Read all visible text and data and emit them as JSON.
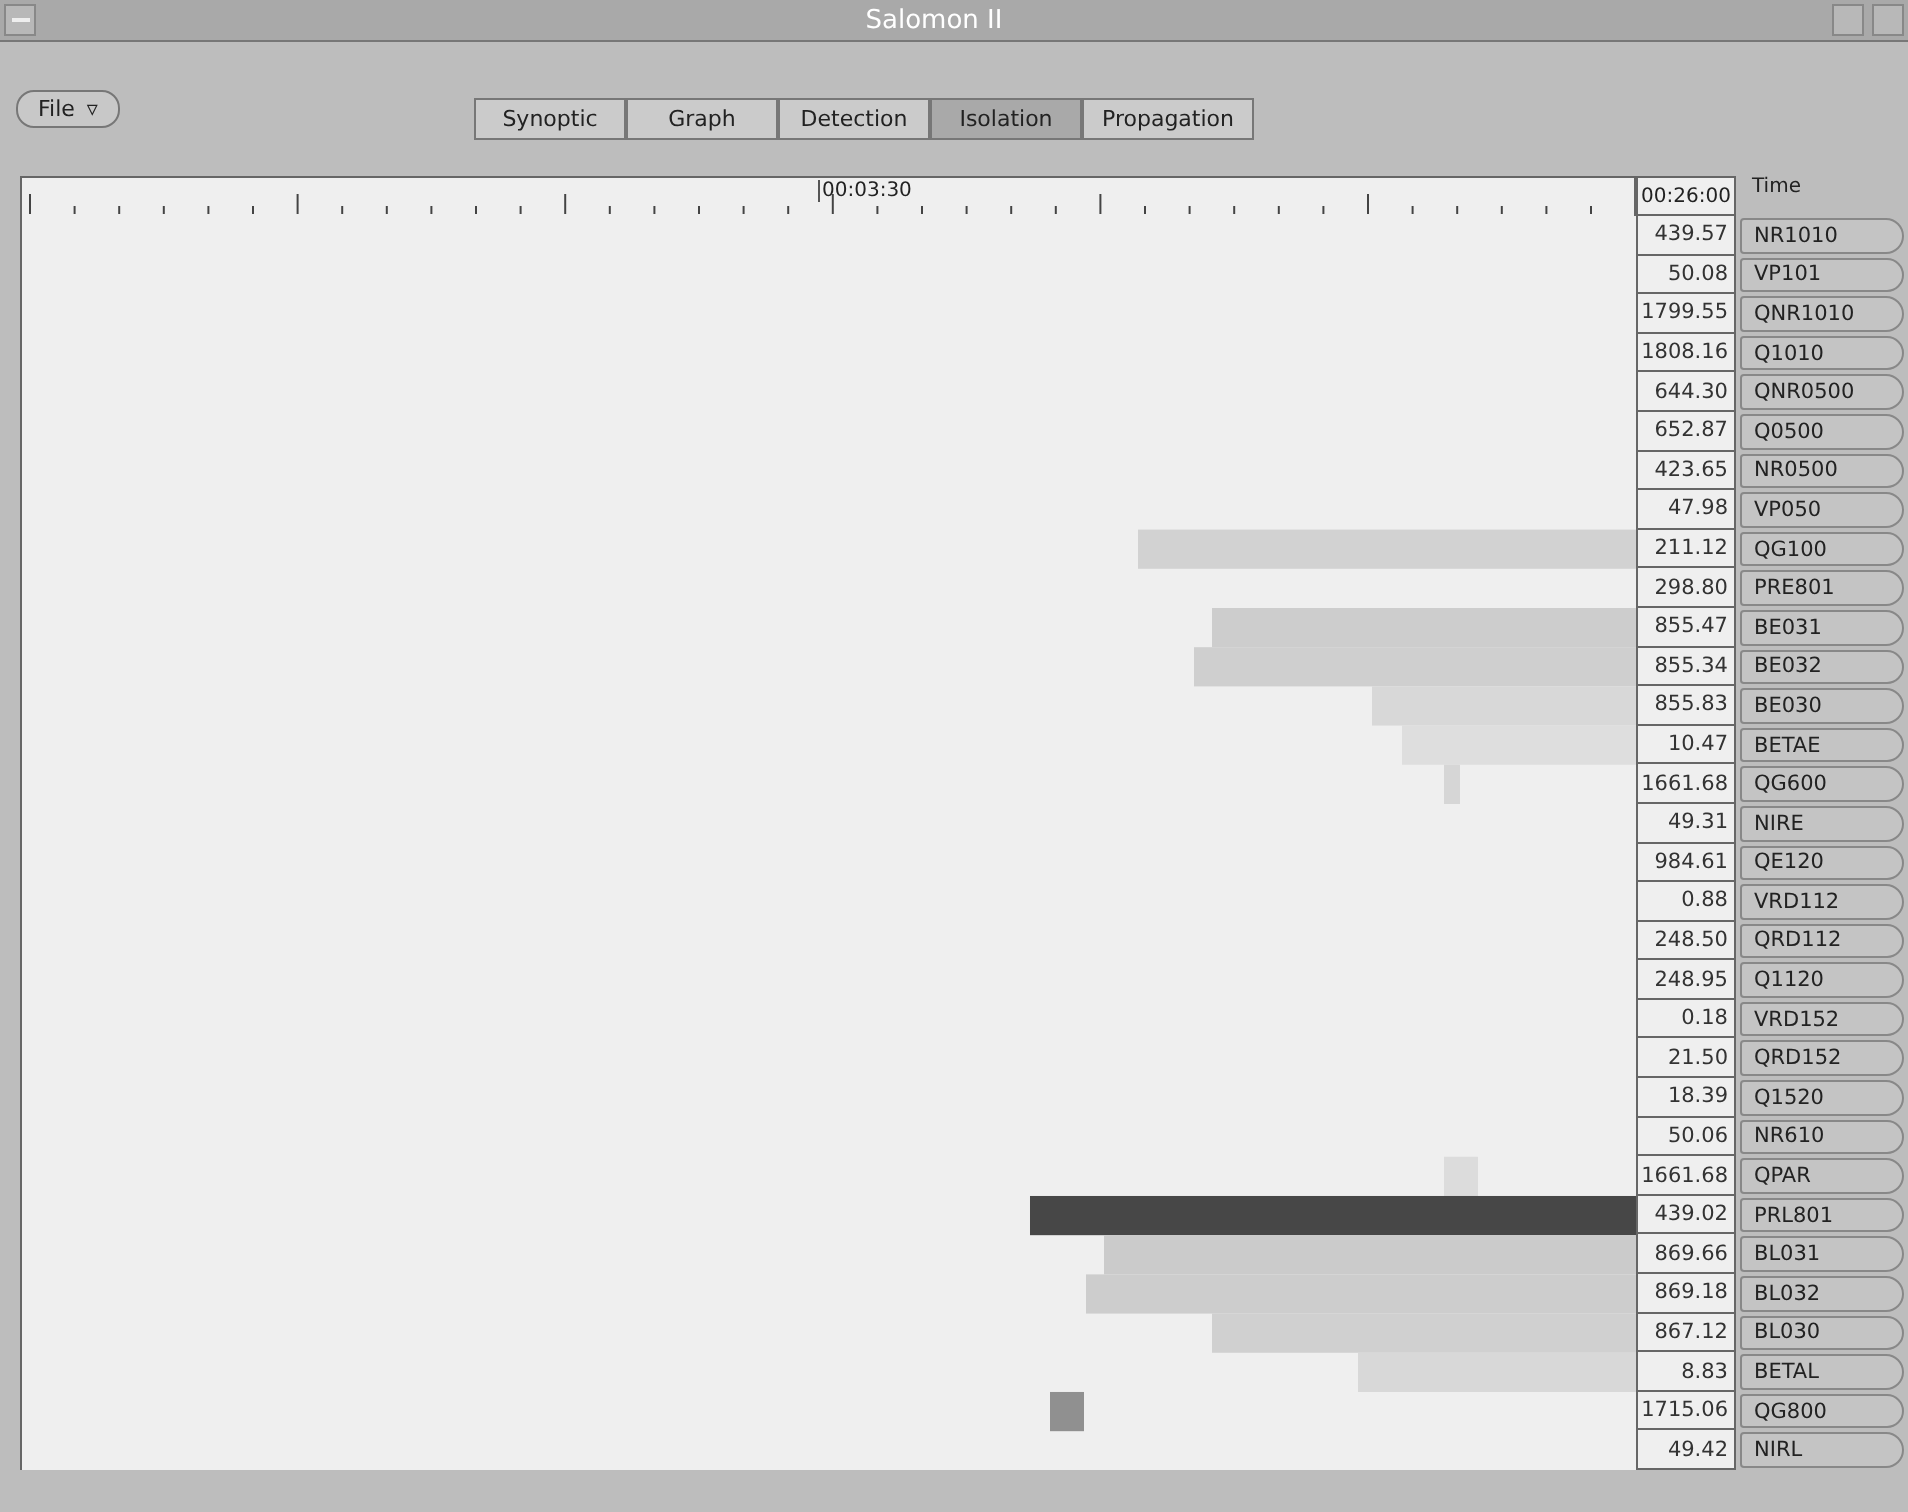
{
  "window": {
    "title": "Salomon II"
  },
  "menu_button": {
    "label": "File",
    "arrow": "▿"
  },
  "tabs": [
    {
      "label": "Synoptic",
      "selected": false
    },
    {
      "label": "Graph",
      "selected": false
    },
    {
      "label": "Detection",
      "selected": false
    },
    {
      "label": "Isolation",
      "selected": true
    },
    {
      "label": "Propagation",
      "selected": false
    }
  ],
  "ruler": {
    "marker": "00:03:30",
    "end_time": "00:26:00"
  },
  "time_header": "Time",
  "rows": [
    {
      "value": "439.57",
      "label": "NR1010"
    },
    {
      "value": "50.08",
      "label": "VP101"
    },
    {
      "value": "1799.55",
      "label": "QNR1010"
    },
    {
      "value": "1808.16",
      "label": "Q1010"
    },
    {
      "value": "644.30",
      "label": "QNR0500"
    },
    {
      "value": "652.87",
      "label": "Q0500"
    },
    {
      "value": "423.65",
      "label": "NR0500"
    },
    {
      "value": "47.98",
      "label": "VP050"
    },
    {
      "value": "211.12",
      "label": "QG100"
    },
    {
      "value": "298.80",
      "label": "PRE801"
    },
    {
      "value": "855.47",
      "label": "BE031"
    },
    {
      "value": "855.34",
      "label": "BE032"
    },
    {
      "value": "855.83",
      "label": "BE030"
    },
    {
      "value": "10.47",
      "label": "BETAE"
    },
    {
      "value": "1661.68",
      "label": "QG600"
    },
    {
      "value": "49.31",
      "label": "NIRE"
    },
    {
      "value": "984.61",
      "label": "QE120"
    },
    {
      "value": "0.88",
      "label": "VRD112"
    },
    {
      "value": "248.50",
      "label": "QRD112"
    },
    {
      "value": "248.95",
      "label": "Q1120"
    },
    {
      "value": "0.18",
      "label": "VRD152"
    },
    {
      "value": "21.50",
      "label": "QRD152"
    },
    {
      "value": "18.39",
      "label": "Q1520"
    },
    {
      "value": "50.06",
      "label": "NR610"
    },
    {
      "value": "1661.68",
      "label": "QPAR"
    },
    {
      "value": "439.02",
      "label": "PRL801"
    },
    {
      "value": "869.66",
      "label": "BL031"
    },
    {
      "value": "869.18",
      "label": "BL032"
    },
    {
      "value": "867.12",
      "label": "BL030"
    },
    {
      "value": "8.83",
      "label": "BETAL"
    },
    {
      "value": "1715.06",
      "label": "QG800"
    },
    {
      "value": "49.42",
      "label": "NIRL"
    }
  ]
}
